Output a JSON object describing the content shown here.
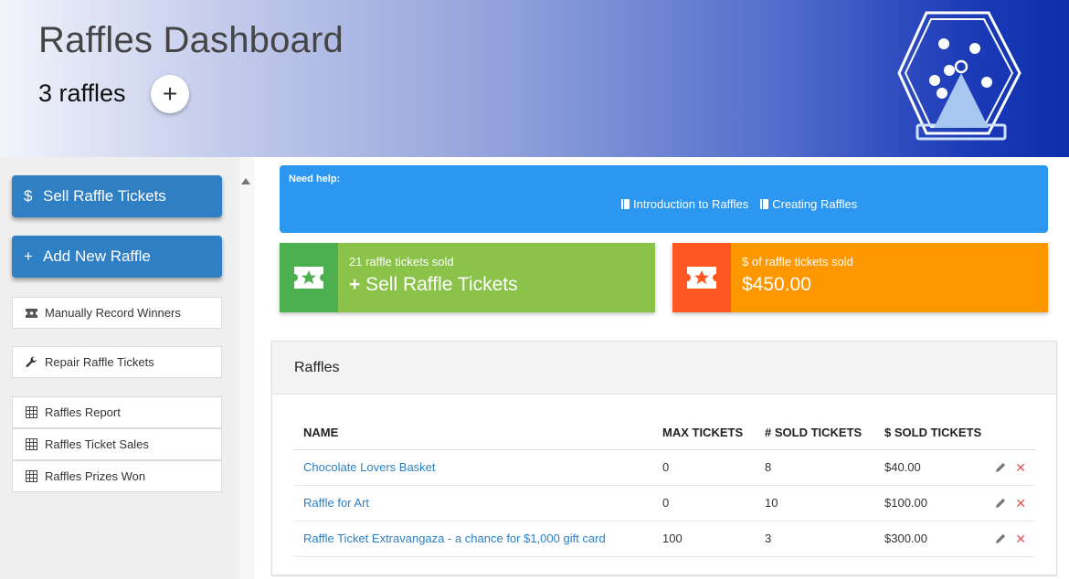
{
  "header": {
    "title": "Raffles Dashboard",
    "count_text": "3 raffles",
    "add_label": "+"
  },
  "sidebar": {
    "sell_button": "Sell Raffle Tickets",
    "sell_icon": "$",
    "add_button": "Add New Raffle",
    "add_icon": "+",
    "items": [
      {
        "label": "Manually Record Winners",
        "icon": "ticket-icon"
      },
      {
        "label": "Repair Raffle Tickets",
        "icon": "wrench-icon"
      },
      {
        "label": "Raffles Report",
        "icon": "grid-icon"
      },
      {
        "label": "Raffles Ticket Sales",
        "icon": "grid-icon"
      },
      {
        "label": "Raffles Prizes Won",
        "icon": "grid-icon"
      }
    ]
  },
  "help": {
    "title": "Need help:",
    "links": [
      "Introduction to Raffles",
      "Creating Raffles"
    ]
  },
  "stats": {
    "tickets": {
      "label": "21 raffle tickets sold",
      "value": "Sell Raffle Tickets",
      "value_icon": "+",
      "icon_color": "#4caf50",
      "bg": "#8bc34a"
    },
    "money": {
      "label": "$ of raffle tickets sold",
      "value": "$450.00",
      "icon_color": "#ff5722",
      "bg": "#ff9800"
    }
  },
  "raffles": {
    "title": "Raffles",
    "columns": [
      "NAME",
      "MAX TICKETS",
      "# SOLD TICKETS",
      "$ SOLD TICKETS"
    ],
    "rows": [
      {
        "name": "Chocolate Lovers Basket",
        "max": "0",
        "sold": "8",
        "amount": "$40.00"
      },
      {
        "name": "Raffle for Art",
        "max": "0",
        "sold": "10",
        "amount": "$100.00"
      },
      {
        "name": "Raffle Ticket Extravangaza - a chance for $1,000 gift card",
        "max": "100",
        "sold": "3",
        "amount": "$300.00"
      }
    ],
    "delete_glyph": "✕"
  }
}
